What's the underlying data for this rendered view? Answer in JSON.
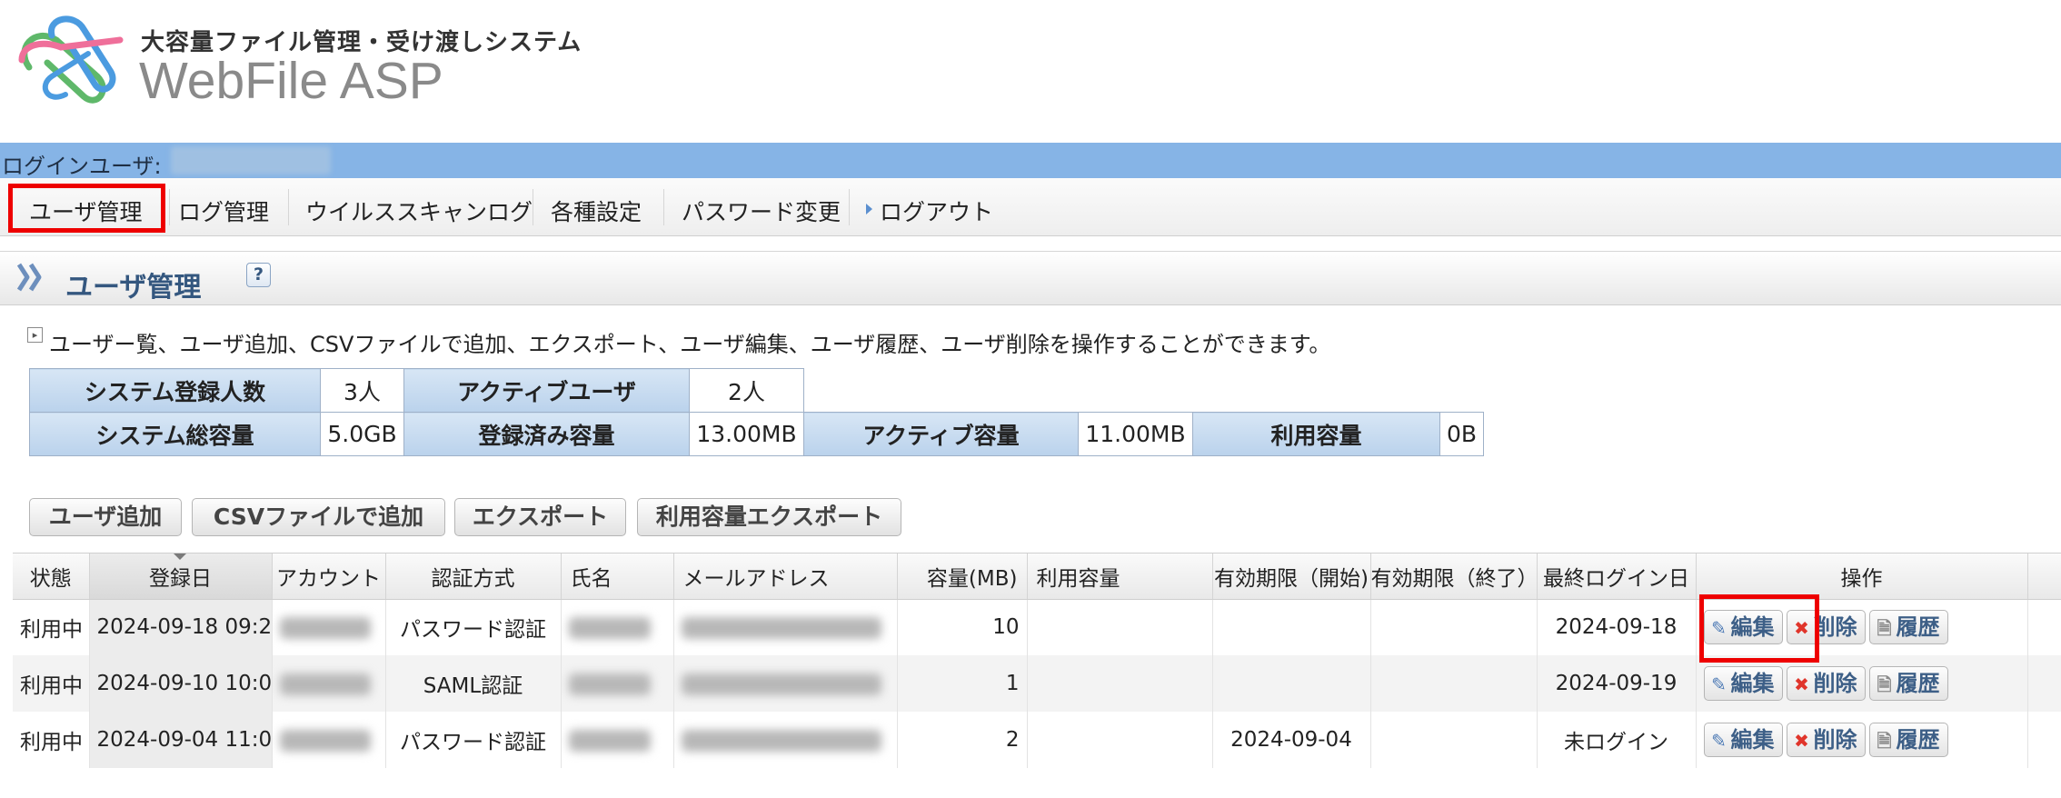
{
  "header": {
    "subtitle": "大容量ファイル管理・受け渡しシステム",
    "title": "WebFile ASP"
  },
  "login": {
    "label": "ログインユーザ:"
  },
  "nav": {
    "items": [
      {
        "label": "ユーザ管理"
      },
      {
        "label": "ログ管理"
      },
      {
        "label": "ウイルススキャンログ"
      },
      {
        "label": "各種設定"
      },
      {
        "label": "パスワード変更"
      },
      {
        "label": "ログアウト"
      }
    ]
  },
  "page": {
    "title": "ユーザ管理",
    "help": "?",
    "description": "ユーザー覧、ユーザ追加、CSVファイルで追加、エクスポート、ユーザ編集、ユーザ履歴、ユーザ削除を操作することができます。"
  },
  "summary": {
    "row1": [
      {
        "label": "システム登録人数",
        "value": "3人"
      },
      {
        "label": "アクティブユーザ",
        "value": "2人"
      }
    ],
    "row2": [
      {
        "label": "システム総容量",
        "value": "5.0GB"
      },
      {
        "label": "登録済み容量",
        "value": "13.00MB"
      },
      {
        "label": "アクティブ容量",
        "value": "11.00MB"
      },
      {
        "label": "利用容量",
        "value": "0B"
      }
    ]
  },
  "actions": {
    "add_user": "ユーザ追加",
    "csv_add": "CSVファイルで追加",
    "export": "エクスポート",
    "usage_export": "利用容量エクスポート"
  },
  "table": {
    "columns": [
      "状態",
      "登録日",
      "アカウント",
      "認証方式",
      "氏名",
      "メールアドレス",
      "容量(MB)",
      "利用容量",
      "有効期限（開始)",
      "有効期限（終了）",
      "最終ログイン日",
      "操作"
    ],
    "rows": [
      {
        "status": "利用中",
        "registered": "2024-09-18 09:2",
        "auth": "パスワード認証",
        "capacity": "10",
        "usage": "",
        "start": "",
        "end": "",
        "last_login": "2024-09-18"
      },
      {
        "status": "利用中",
        "registered": "2024-09-10 10:0",
        "auth": "SAML認証",
        "capacity": "1",
        "usage": "",
        "start": "",
        "end": "",
        "last_login": "2024-09-19"
      },
      {
        "status": "利用中",
        "registered": "2024-09-04 11:0",
        "auth": "パスワード認証",
        "capacity": "2",
        "usage": "",
        "start": "2024-09-04",
        "end": "",
        "last_login": "未ログイン"
      }
    ],
    "op_labels": {
      "edit": "編集",
      "delete": "削除",
      "history": "履歴"
    }
  },
  "colors": {
    "login_bar": "#86b4e6",
    "highlight": "#ee0000",
    "heading_text": "#34577f"
  }
}
